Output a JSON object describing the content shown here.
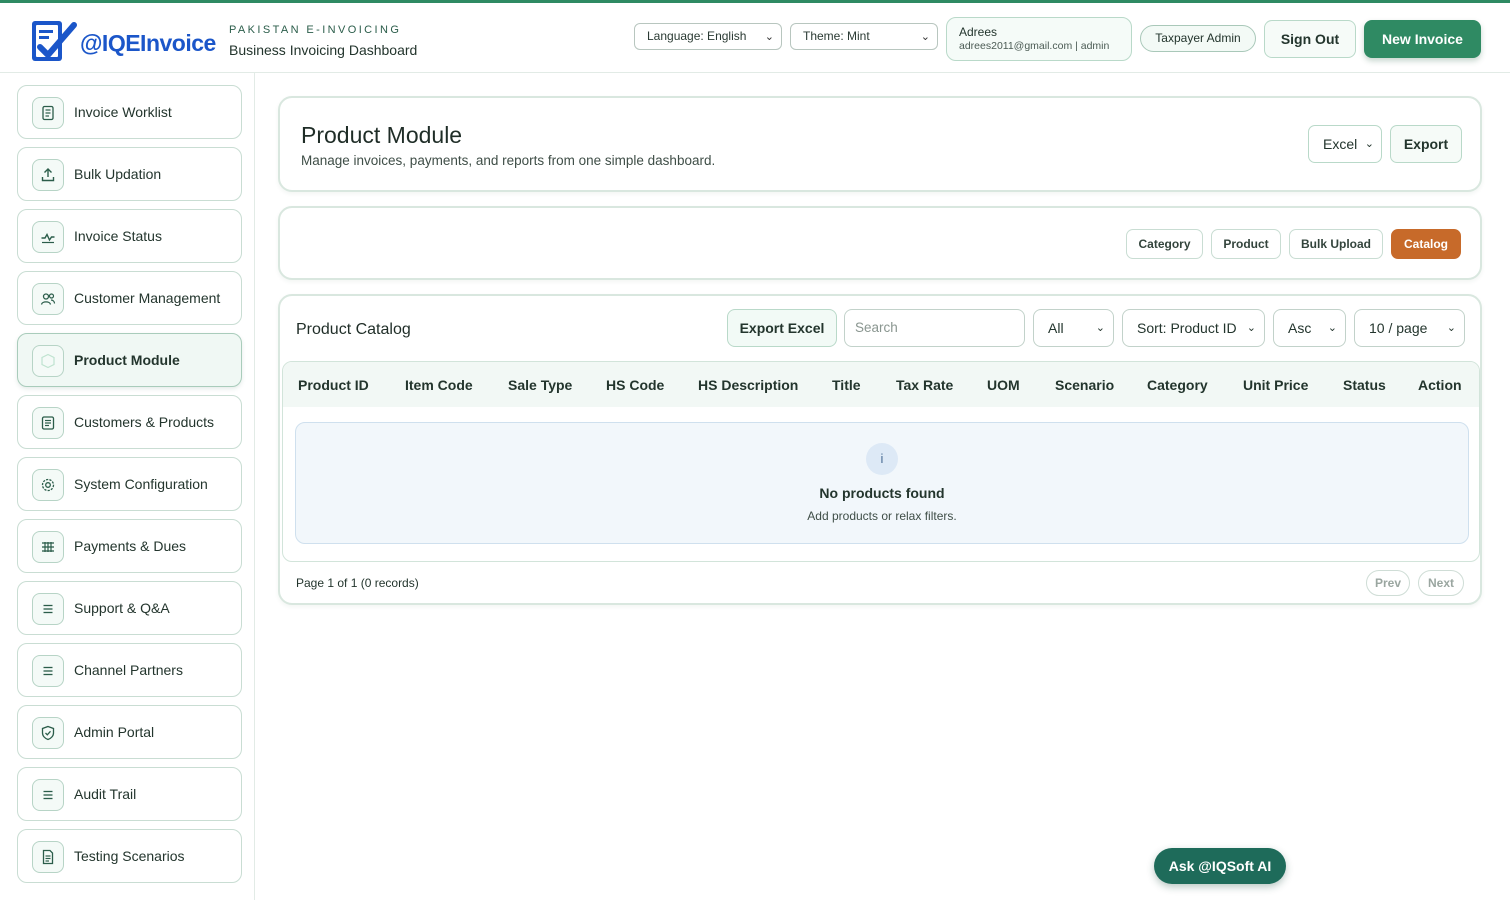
{
  "header": {
    "brand": "@IQEInvoice",
    "subtitle": "PAKISTAN E-INVOICING",
    "title": "Business Invoicing Dashboard",
    "language": "Language: English",
    "theme": "Theme: Mint",
    "user": {
      "name": "Adrees",
      "email": "adrees2011@gmail.com | admin"
    },
    "role": "Taxpayer Admin",
    "sign_out": "Sign Out",
    "new_invoice": "New Invoice"
  },
  "sidebar": {
    "items": [
      {
        "label": "Invoice Worklist",
        "icon": "document-icon"
      },
      {
        "label": "Bulk Updation",
        "icon": "upload-icon"
      },
      {
        "label": "Invoice Status",
        "icon": "pulse-icon"
      },
      {
        "label": "Customer Management",
        "icon": "users-icon"
      },
      {
        "label": "Product Module",
        "icon": "box-icon",
        "active": true
      },
      {
        "label": "Customers & Products",
        "icon": "document-icon"
      },
      {
        "label": "System Configuration",
        "icon": "gear-icon"
      },
      {
        "label": "Payments & Dues",
        "icon": "table-icon"
      },
      {
        "label": "Support & Q&A",
        "icon": "menu-icon"
      },
      {
        "label": "Channel Partners",
        "icon": "menu-icon"
      },
      {
        "label": "Admin Portal",
        "icon": "shield-icon"
      },
      {
        "label": "Audit Trail",
        "icon": "menu-icon"
      },
      {
        "label": "Testing Scenarios",
        "icon": "file-icon"
      }
    ]
  },
  "page": {
    "title": "Product Module",
    "description": "Manage invoices, payments, and reports from one simple dashboard.",
    "export_format": "Excel",
    "export_label": "Export"
  },
  "tabs": [
    {
      "label": "Category",
      "active": false
    },
    {
      "label": "Product",
      "active": false
    },
    {
      "label": "Bulk Upload",
      "active": false
    },
    {
      "label": "Catalog",
      "active": true
    }
  ],
  "catalog": {
    "title": "Product Catalog",
    "export_excel": "Export Excel",
    "search_placeholder": "Search",
    "filter": "All",
    "sort": "Sort: Product ID",
    "order": "Asc",
    "page_size": "10 / page",
    "columns": [
      "Product ID",
      "Item Code",
      "Sale Type",
      "HS Code",
      "HS Description",
      "Title",
      "Tax Rate",
      "UOM",
      "Scenario",
      "Category",
      "Unit Price",
      "Status",
      "Action"
    ],
    "empty_icon": "i",
    "empty_title": "No products found",
    "empty_hint": "Add products or relax filters.",
    "page_info": "Page 1 of 1 (0 records)",
    "prev": "Prev",
    "next": "Next"
  },
  "assistant": {
    "label": "Ask @IQSoft AI"
  },
  "colors": {
    "accent": "#2f8a63",
    "catalog_tab": "#c76a2a",
    "brand": "#1b56c9",
    "assistant": "#1e6b5a"
  }
}
